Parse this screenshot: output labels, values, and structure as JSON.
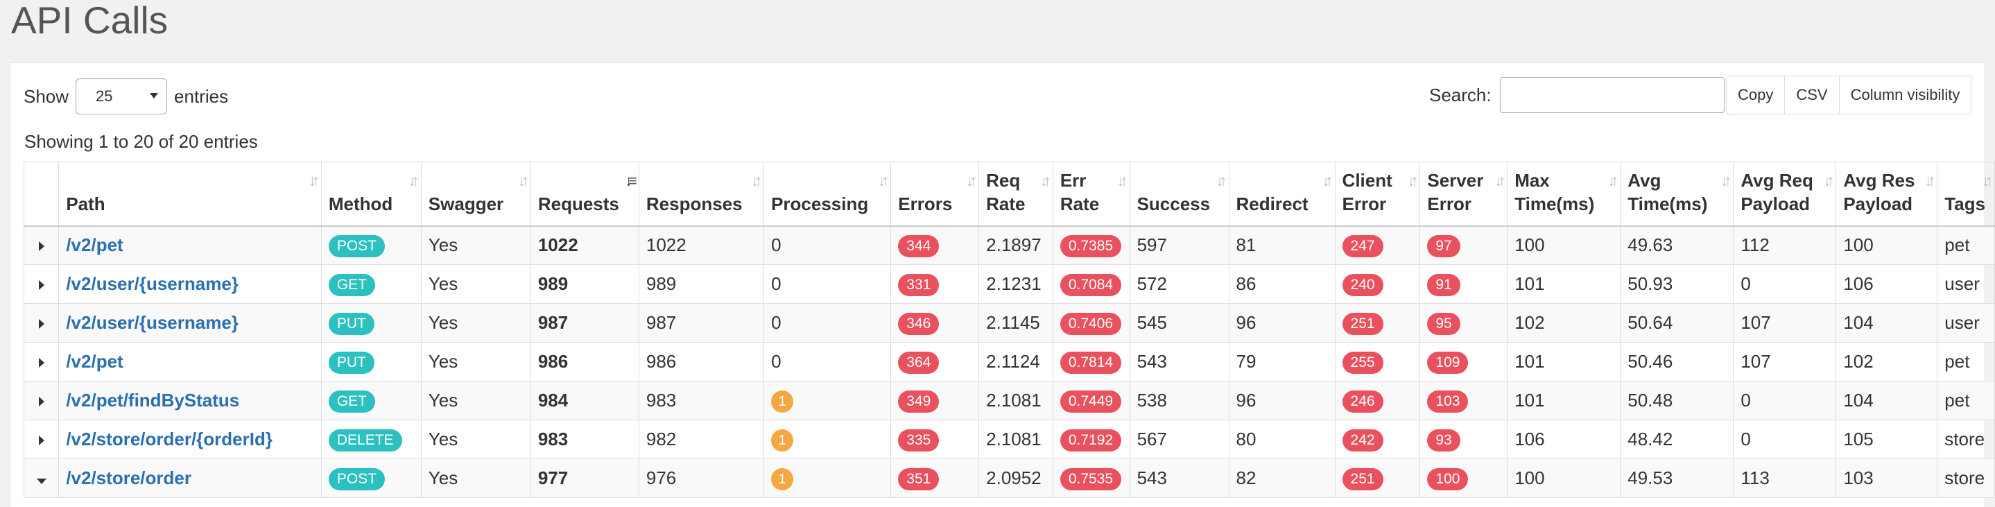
{
  "page": {
    "title": "API Calls"
  },
  "length_control": {
    "show_label": "Show",
    "value": "25",
    "entries_label": "entries"
  },
  "search": {
    "label": "Search:",
    "value": ""
  },
  "buttons": {
    "copy": "Copy",
    "csv": "CSV",
    "column_visibility": "Column visibility"
  },
  "info": "Showing 1 to 20 of 20 entries",
  "columns": [
    "Path",
    "Method",
    "Swagger",
    "Requests",
    "Responses",
    "Processing",
    "Errors",
    "Req Rate",
    "Err Rate",
    "Success",
    "Redirect",
    "Client Error",
    "Server Error",
    "Max Time(ms)",
    "Avg Time(ms)",
    "Avg Req Payload",
    "Avg Res Payload",
    "Tags"
  ],
  "sort_icons": {
    "default": "sort-both-icon",
    "active": "sort-desc-icon"
  },
  "rows": [
    {
      "expanded": false,
      "path": "/v2/pet",
      "method": "POST",
      "swagger": "Yes",
      "requests": "1022",
      "responses": "1022",
      "processing": "0",
      "errors": "344",
      "req_rate": "2.1897",
      "err_rate": "0.7385",
      "success": "597",
      "redirect": "81",
      "client_error": "247",
      "server_error": "97",
      "max_time": "100",
      "avg_time": "49.63",
      "avg_req_payload": "112",
      "avg_res_payload": "100",
      "tags": "pet"
    },
    {
      "expanded": false,
      "path": "/v2/user/{username}",
      "method": "GET",
      "swagger": "Yes",
      "requests": "989",
      "responses": "989",
      "processing": "0",
      "errors": "331",
      "req_rate": "2.1231",
      "err_rate": "0.7084",
      "success": "572",
      "redirect": "86",
      "client_error": "240",
      "server_error": "91",
      "max_time": "101",
      "avg_time": "50.93",
      "avg_req_payload": "0",
      "avg_res_payload": "106",
      "tags": "user"
    },
    {
      "expanded": false,
      "path": "/v2/user/{username}",
      "method": "PUT",
      "swagger": "Yes",
      "requests": "987",
      "responses": "987",
      "processing": "0",
      "errors": "346",
      "req_rate": "2.1145",
      "err_rate": "0.7406",
      "success": "545",
      "redirect": "96",
      "client_error": "251",
      "server_error": "95",
      "max_time": "102",
      "avg_time": "50.64",
      "avg_req_payload": "107",
      "avg_res_payload": "104",
      "tags": "user"
    },
    {
      "expanded": false,
      "path": "/v2/pet",
      "method": "PUT",
      "swagger": "Yes",
      "requests": "986",
      "responses": "986",
      "processing": "0",
      "errors": "364",
      "req_rate": "2.1124",
      "err_rate": "0.7814",
      "success": "543",
      "redirect": "79",
      "client_error": "255",
      "server_error": "109",
      "max_time": "101",
      "avg_time": "50.46",
      "avg_req_payload": "107",
      "avg_res_payload": "102",
      "tags": "pet"
    },
    {
      "expanded": false,
      "path": "/v2/pet/findByStatus",
      "method": "GET",
      "swagger": "Yes",
      "requests": "984",
      "responses": "983",
      "processing": "1",
      "errors": "349",
      "req_rate": "2.1081",
      "err_rate": "0.7449",
      "success": "538",
      "redirect": "96",
      "client_error": "246",
      "server_error": "103",
      "max_time": "101",
      "avg_time": "50.48",
      "avg_req_payload": "0",
      "avg_res_payload": "104",
      "tags": "pet"
    },
    {
      "expanded": false,
      "path": "/v2/store/order/{orderId}",
      "method": "DELETE",
      "swagger": "Yes",
      "requests": "983",
      "responses": "982",
      "processing": "1",
      "errors": "335",
      "req_rate": "2.1081",
      "err_rate": "0.7192",
      "success": "567",
      "redirect": "80",
      "client_error": "242",
      "server_error": "93",
      "max_time": "106",
      "avg_time": "48.42",
      "avg_req_payload": "0",
      "avg_res_payload": "105",
      "tags": "store"
    },
    {
      "expanded": true,
      "path": "/v2/store/order",
      "method": "POST",
      "swagger": "Yes",
      "requests": "977",
      "responses": "976",
      "processing": "1",
      "errors": "351",
      "req_rate": "2.0952",
      "err_rate": "0.7535",
      "success": "543",
      "redirect": "82",
      "client_error": "251",
      "server_error": "100",
      "max_time": "100",
      "avg_time": "49.53",
      "avg_req_payload": "113",
      "avg_res_payload": "103",
      "tags": "store"
    }
  ]
}
